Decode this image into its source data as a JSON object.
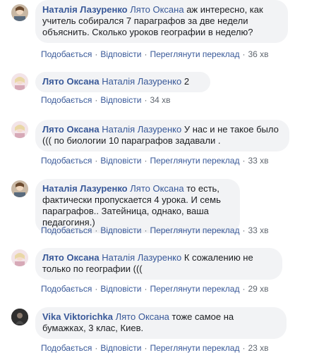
{
  "actions_labels": {
    "like": "Подобається",
    "reply": "Відповісти",
    "translate": "Переглянути переклад",
    "separator": "·"
  },
  "comments": [
    {
      "author": "Наталія Лазуренко",
      "mention": "Лято Оксана",
      "text": "аж интересно, как учитель собирался 7 параграфов за две недели объяснить. Сколько уроков географии в неделю?",
      "time": "36 хв",
      "show_translate": true
    },
    {
      "author": "Лято Оксана",
      "mention": "Наталія Лазуренко",
      "text": "2",
      "time": "34 хв",
      "show_translate": false
    },
    {
      "author": "Лято Оксана",
      "mention": "Наталія Лазуренко",
      "text": "У нас и не такое было ((( по биологии 10 параграфов задавали .",
      "time": "33 хв",
      "show_translate": true
    },
    {
      "author": "Наталія Лазуренко",
      "mention": "Лято Оксана",
      "text": "то есть, фактически пропускается 4 урока. И семь параграфов.. Затейница, однако, ваша педагогиня.)",
      "time": "33 хв",
      "show_translate": true
    },
    {
      "author": "Лято Оксана",
      "mention": "Наталія Лазуренко",
      "text": "К сожалению не только по географии (((",
      "time": "29 хв",
      "show_translate": true
    },
    {
      "author": "Vika Viktorichka",
      "mention": "Лято Оксана",
      "text": "тоже самое на бумажках, 3 клас, Киев.",
      "time": "23 хв",
      "show_translate": true
    }
  ]
}
